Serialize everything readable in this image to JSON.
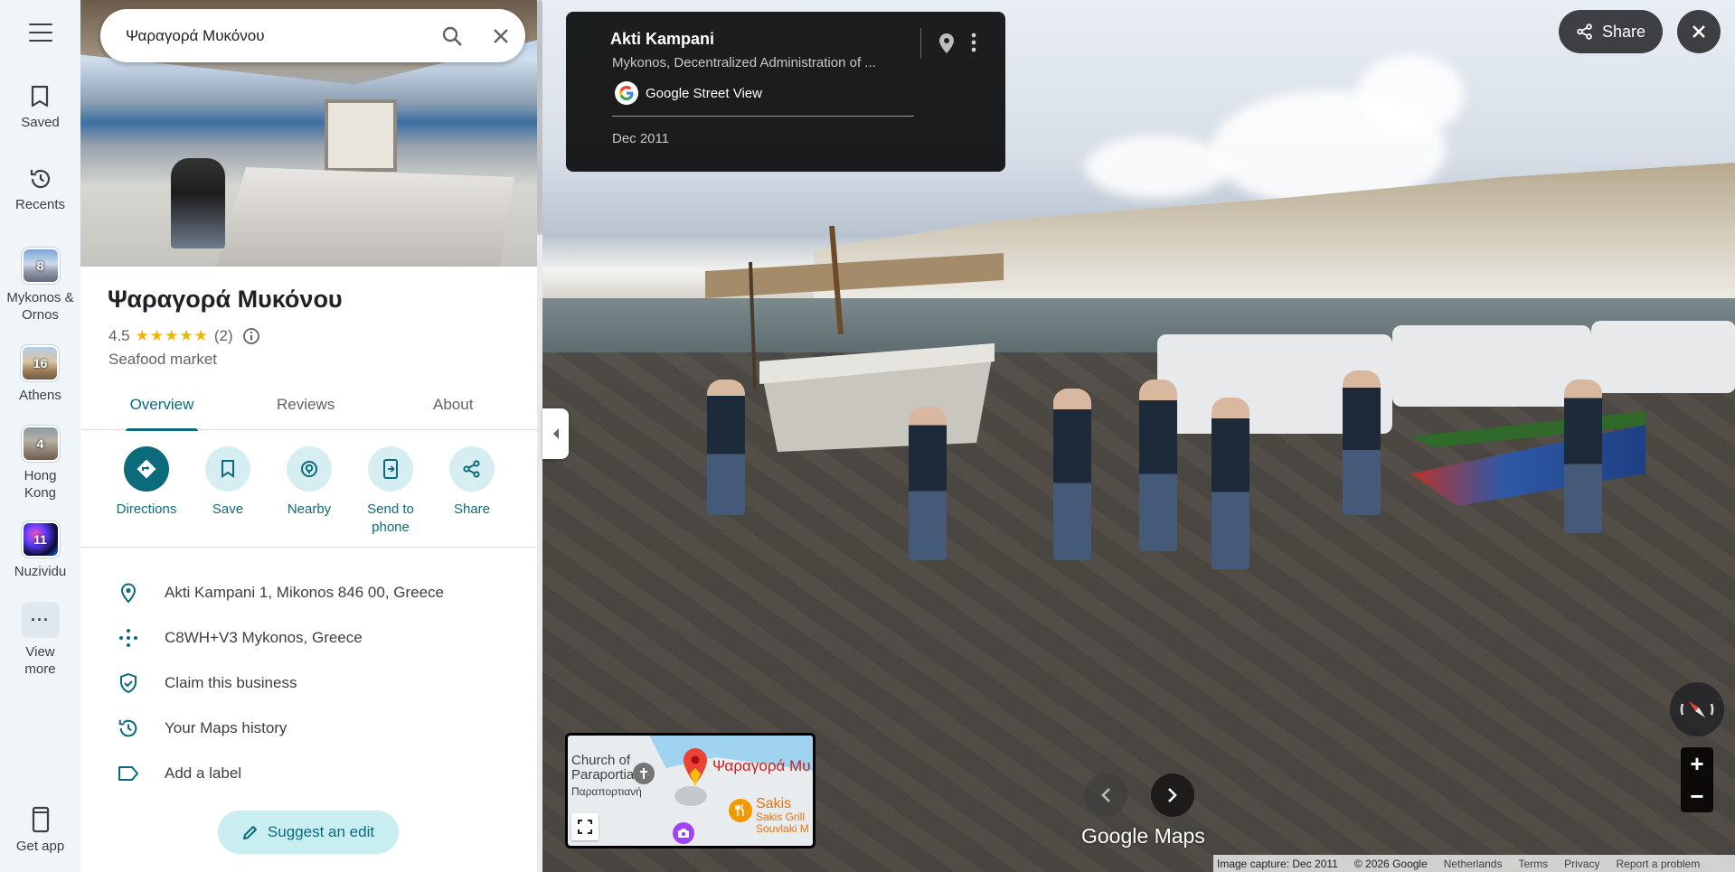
{
  "search": {
    "query": "Ψαραγορά Μυκόνου"
  },
  "rail": {
    "saved": "Saved",
    "recents": "Recents",
    "places": [
      {
        "count": "8",
        "label": "Mykonos & Ornos"
      },
      {
        "count": "16",
        "label": "Athens"
      },
      {
        "count": "4",
        "label": "Hong Kong"
      },
      {
        "count": "11",
        "label": "Nuzividu"
      }
    ],
    "view_more": "View more",
    "get_app": "Get app"
  },
  "place": {
    "title": "Ψαραγορά Μυκόνου",
    "rating": "4.5",
    "stars": "★★★★★",
    "rating_fraction": 0.9,
    "reviews_count": "(2)",
    "category": "Seafood market"
  },
  "tabs": {
    "overview": "Overview",
    "reviews": "Reviews",
    "about": "About",
    "active": "Overview"
  },
  "actions": {
    "directions": "Directions",
    "save": "Save",
    "nearby": "Nearby",
    "send_to_phone": "Send to phone",
    "share": "Share"
  },
  "info": {
    "address": "Akti Kampani 1, Mikonos 846 00, Greece",
    "plus_code": "C8WH+V3 Mykonos, Greece",
    "claim": "Claim this business",
    "history": "Your Maps history",
    "label": "Add a label"
  },
  "suggest_edit": "Suggest an edit",
  "streetview": {
    "title": "Akti Kampani",
    "subtitle": "Mykonos, Decentralized Administration of ...",
    "source": "Google Street View",
    "date": "Dec 2011",
    "share": "Share",
    "logo_google": "Google",
    "logo_maps": "Maps",
    "zoom_in": "+",
    "zoom_out": "−"
  },
  "minimap": {
    "church": "Church of\nParaportiani",
    "church_line1": "Church of",
    "church_line2": "Paraportiani",
    "church_greek": "Παραπορτιανή",
    "place": "Ψαραγορά Μυ",
    "sakis": "Sakis",
    "sakis_sub1": "Sakis Grill",
    "sakis_sub2": "Souvlaki M"
  },
  "footer": {
    "capture": "Image capture: Dec 2011",
    "copyright": "© 2026 Google",
    "country": "Netherlands",
    "terms": "Terms",
    "privacy": "Privacy",
    "report": "Report a problem"
  },
  "colors": {
    "accent": "#0b6b7a",
    "accent_light": "#d6eef2",
    "star": "#f4b400",
    "rail_bg": "#f0f5f9"
  }
}
